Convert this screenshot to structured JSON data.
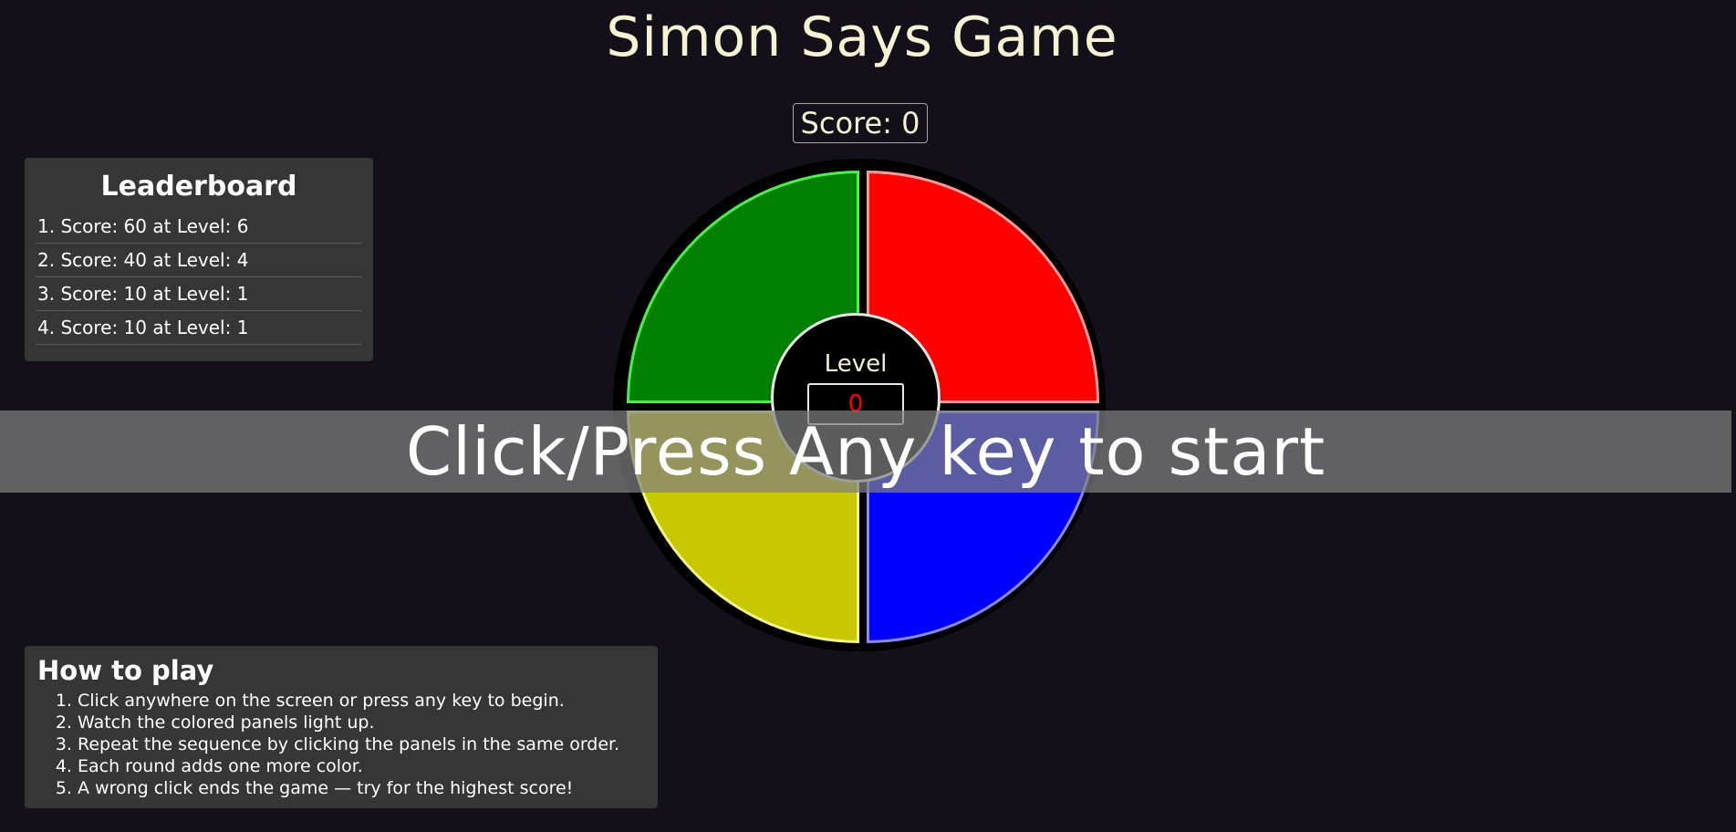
{
  "header": {
    "title": "Simon Says Game",
    "score_text": "Score: 0"
  },
  "leaderboard": {
    "title": "Leaderboard",
    "entries": [
      "1. Score: 60 at Level: 6",
      "2. Score: 40 at Level: 4",
      "3. Score: 10 at Level: 1",
      "4. Score: 10 at Level: 1"
    ]
  },
  "board": {
    "panels": [
      {
        "color_name": "green",
        "color": "#008000"
      },
      {
        "color_name": "red",
        "color": "#ff0000"
      },
      {
        "color_name": "yellow",
        "color": "#c8c800"
      },
      {
        "color_name": "blue",
        "color": "#0000ff"
      }
    ],
    "level_label": "Level",
    "level_value": "0"
  },
  "overlay": {
    "text": "Click/Press Any key to start"
  },
  "how_to_play": {
    "title": "How to play",
    "steps": [
      "Click anywhere on the screen or press any key to begin.",
      "Watch the colored panels light up.",
      "Repeat the sequence by clicking the panels in the same order.",
      "Each round adds one more color.",
      "A wrong click ends the game — try for the highest score!"
    ]
  }
}
